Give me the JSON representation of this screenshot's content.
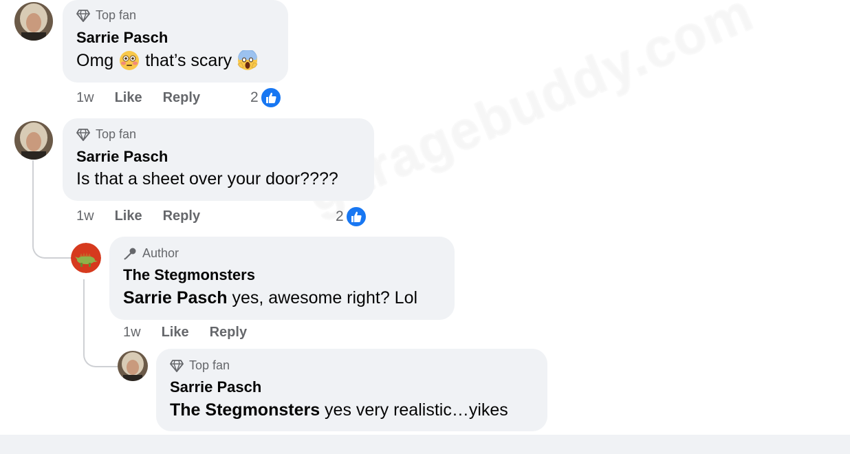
{
  "comments": [
    {
      "badge": "Top fan",
      "author": "Sarrie Pasch",
      "text_before_emoji": "Omg",
      "text_middle": "that’s scary",
      "emoji_1": "flushed-face",
      "emoji_2": "screaming-face",
      "time": "1w",
      "like_label": "Like",
      "reply_label": "Reply",
      "reaction_count": "2"
    },
    {
      "badge": "Top fan",
      "author": "Sarrie Pasch",
      "text": "Is that a sheet over your door????",
      "time": "1w",
      "like_label": "Like",
      "reply_label": "Reply",
      "reaction_count": "2"
    },
    {
      "badge": "Author",
      "author": "The Stegmonsters",
      "mention": "Sarrie Pasch",
      "text": " yes, awesome right? Lol",
      "time": "1w",
      "like_label": "Like",
      "reply_label": "Reply"
    },
    {
      "badge": "Top fan",
      "author": "Sarrie Pasch",
      "mention": "The Stegmonsters",
      "text": " yes very realistic…yikes"
    }
  ],
  "watermark": "garagebuddy.com",
  "colors": {
    "bubble": "#f0f2f5",
    "meta_text": "#65676b",
    "like_blue": "#1877f2",
    "thread_line": "#ced0d4"
  },
  "icons": {
    "top_fan_badge": "diamond-icon",
    "author_badge": "microphone-icon",
    "reaction": "thumbs-up-icon"
  }
}
